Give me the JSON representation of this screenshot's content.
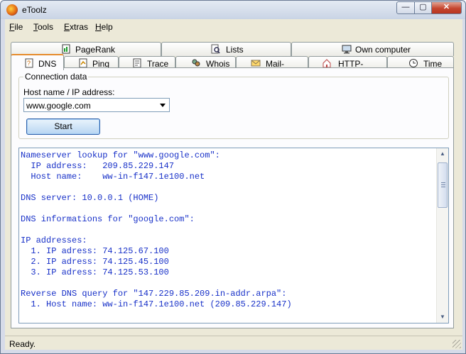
{
  "window": {
    "title": "eToolz",
    "min_glyph": "—",
    "max_glyph": "▢",
    "close_glyph": "✕"
  },
  "menu": [
    {
      "accel": "F",
      "rest": "ile"
    },
    {
      "accel": "T",
      "rest": "ools"
    },
    {
      "accel": "E",
      "rest": "xtras"
    },
    {
      "accel": "H",
      "rest": "elp"
    }
  ],
  "tabs_row1": [
    "PageRank",
    "Lists",
    "Own computer"
  ],
  "tabs_row2": [
    "DNS",
    "Ping",
    "Trace",
    "Whois",
    "Mail-Check",
    "HTTP-Header",
    "Time"
  ],
  "active_tab": "DNS",
  "connection": {
    "group_title": "Connection data",
    "field_label": "Host name / IP address:",
    "host_value": "www.google.com",
    "start_label": "Start"
  },
  "output_lines": [
    {
      "text": "Nameserver lookup for \"www.google.com\":",
      "color": "#1730c8"
    },
    {
      "text": "  IP address:   209.85.229.147",
      "color": "#1730c8"
    },
    {
      "text": "  Host name:    ww-in-f147.1e100.net",
      "color": "#1730c8"
    },
    {
      "text": "",
      "color": "#000000"
    },
    {
      "text": "DNS server: 10.0.0.1 (HOME)",
      "color": "#1730c8"
    },
    {
      "text": "",
      "color": "#000000"
    },
    {
      "text": "DNS informations for \"google.com\":",
      "color": "#1730c8"
    },
    {
      "text": "",
      "color": "#000000"
    },
    {
      "text": "IP addresses:",
      "color": "#1730c8"
    },
    {
      "text": "  1. IP adress: 74.125.67.100",
      "color": "#1730c8"
    },
    {
      "text": "  2. IP adress: 74.125.45.100",
      "color": "#1730c8"
    },
    {
      "text": "  3. IP adress: 74.125.53.100",
      "color": "#1730c8"
    },
    {
      "text": "",
      "color": "#000000"
    },
    {
      "text": "Reverse DNS query for \"147.229.85.209.in-addr.arpa\":",
      "color": "#1730c8"
    },
    {
      "text": "  1. Host name: ww-in-f147.1e100.net (209.85.229.147)",
      "color": "#1730c8"
    }
  ],
  "status": {
    "text": "Ready."
  },
  "icons": {
    "app": "etoolz-app-icon",
    "pagerank": "pagerank-icon",
    "lists": "lists-icon",
    "own_computer": "own-computer-icon",
    "dns": "dns-icon",
    "ping": "ping-icon",
    "trace": "trace-icon",
    "whois": "whois-icon",
    "mail": "mail-check-icon",
    "http": "http-header-icon",
    "time": "time-icon"
  }
}
